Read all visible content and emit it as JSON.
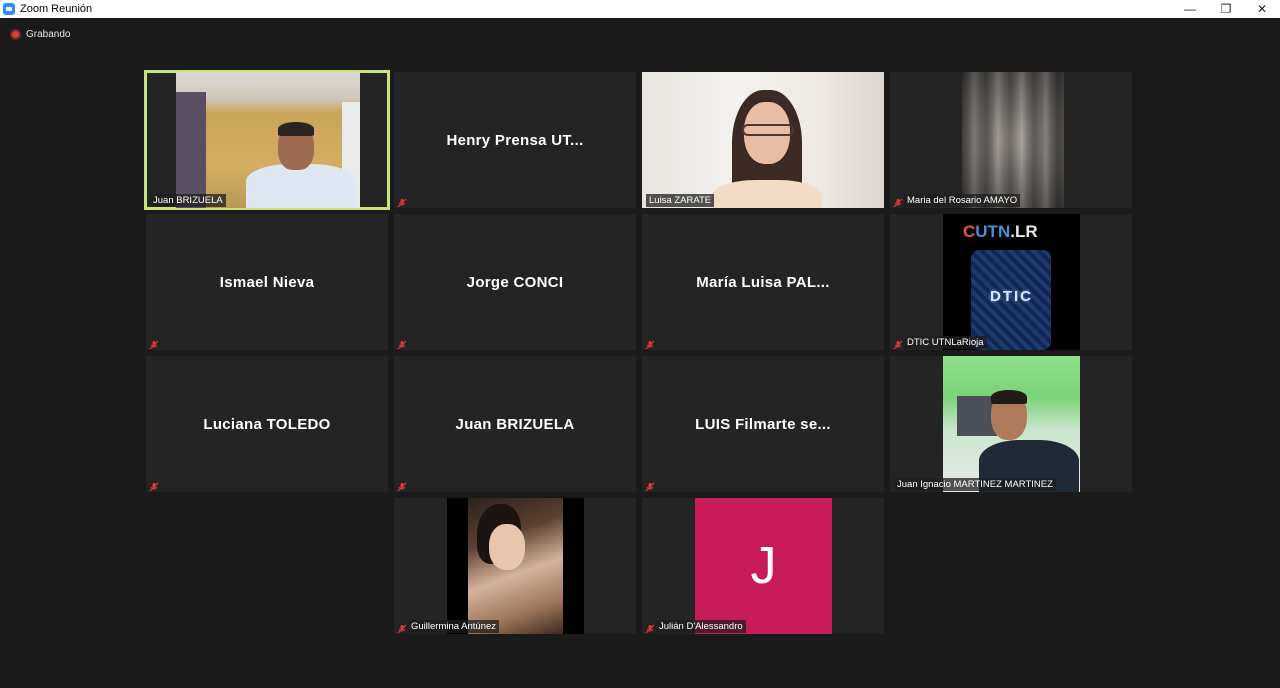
{
  "window": {
    "title": "Zoom Reunión",
    "minimize": "—",
    "restore": "❐",
    "close": "✕"
  },
  "recording": {
    "label": "Grabando"
  },
  "colors": {
    "active_speaker": "#c6e37c",
    "mute_icon": "#e03a3a",
    "avatar_bg": "#c81c5a"
  },
  "participants": [
    {
      "name": "Juan BRIZUELA",
      "video": true,
      "active": true,
      "muted": false
    },
    {
      "name": "Henry Prensa UT...",
      "tag": "",
      "video": false,
      "muted": true
    },
    {
      "name": "Luisa ZARATE",
      "video": true,
      "muted": false
    },
    {
      "name": "Maria del Rosario AMAYO",
      "video": true,
      "muted": true
    },
    {
      "name": "Ismael Nieva",
      "video": false,
      "muted": true
    },
    {
      "name": "Jorge CONCI",
      "video": false,
      "muted": true
    },
    {
      "name": "María Luisa PAL...",
      "video": false,
      "muted": true
    },
    {
      "name": "DTIC UTNLaRioja",
      "video": true,
      "muted": true,
      "logo_main": "UTN",
      "logo_suffix": ".LR",
      "logo_ring": "C",
      "logo_center": "DTIC"
    },
    {
      "name": "Luciana TOLEDO",
      "video": false,
      "muted": true
    },
    {
      "name": "Juan BRIZUELA",
      "video": false,
      "muted": true
    },
    {
      "name": "LUIS Filmarte se...",
      "video": false,
      "muted": true
    },
    {
      "name": "Juan Ignacio MARTINEZ MARTINEZ",
      "video": true,
      "muted": false
    },
    {
      "name": "Guillermina Antúnez",
      "video": true,
      "muted": true
    },
    {
      "name": "Julián D'Alessandro",
      "video": true,
      "muted": true,
      "initial": "J"
    }
  ]
}
